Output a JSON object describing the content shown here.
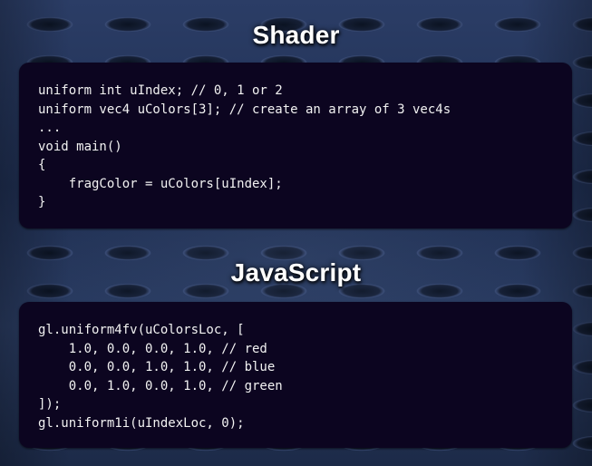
{
  "shader_section": {
    "title": "Shader",
    "code_lines": [
      "uniform int uIndex; // 0, 1 or 2",
      "uniform vec4 uColors[3]; // create an array of 3 vec4s",
      "...",
      "void main()",
      "{",
      "    fragColor = uColors[uIndex];",
      "}"
    ]
  },
  "javascript_section": {
    "title": "JavaScript",
    "code_lines": [
      "gl.uniform4fv(uColorsLoc, [",
      "    1.0, 0.0, 0.0, 1.0, // red",
      "    0.0, 0.0, 1.0, 1.0, // blue",
      "    0.0, 1.0, 0.0, 1.0, // green",
      "]);",
      "gl.uniform1i(uIndexLoc, 0);"
    ]
  },
  "colors": {
    "background": "#25375f",
    "panel": "#0c0520",
    "text": "#f2f2f2",
    "heading": "#ffffff"
  }
}
